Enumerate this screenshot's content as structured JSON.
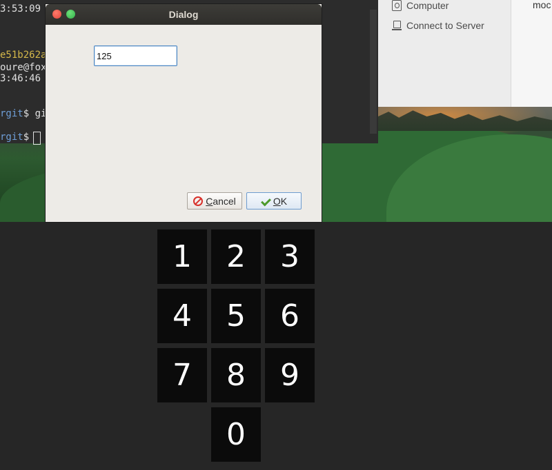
{
  "terminal": {
    "lines": [
      {
        "text": "3:53:09",
        "color": "#e0e0e0"
      },
      {
        "text": "e51b262a",
        "color": "#d4b84a"
      },
      {
        "text": "oure@fox",
        "color": "#e0e0e0"
      },
      {
        "text": "3:46:46",
        "color": "#e0e0e0"
      },
      {
        "prompt": "rgit",
        "rest": "$ gi"
      },
      {
        "prompt": "rgit",
        "rest": "$ "
      }
    ],
    "prompt_color": "#6f9fd8"
  },
  "files": {
    "places": [
      {
        "label": "Computer",
        "icon": "computer-icon"
      },
      {
        "label": "Connect to Server",
        "icon": "server-icon"
      }
    ],
    "main_text": "moc"
  },
  "dialog": {
    "title": "Dialog",
    "input_value": "125",
    "cancel": {
      "mnemonic": "C",
      "rest": "ancel",
      "icon": "cancel-icon",
      "color": "#d8302a"
    },
    "ok": {
      "mnemonic": "O",
      "rest": "K",
      "icon": "checkmark-icon",
      "color": "#4c9a2a"
    }
  },
  "keypad": {
    "keys": [
      "1",
      "2",
      "3",
      "4",
      "5",
      "6",
      "7",
      "8",
      "9",
      "0"
    ]
  }
}
